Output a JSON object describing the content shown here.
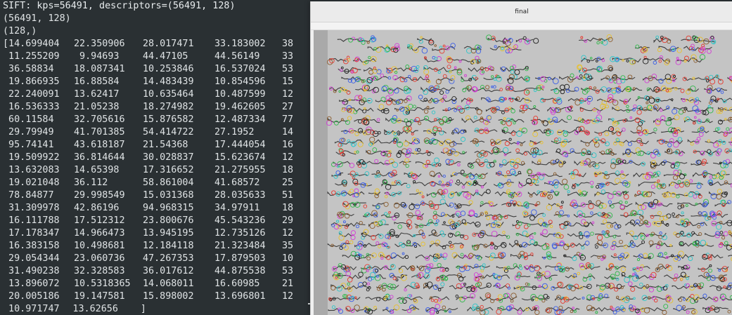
{
  "terminal": {
    "header_lines": [
      "SIFT: kps=56491, descriptors=(56491, 128)",
      "(56491, 128)",
      "(128,)"
    ],
    "vector_rows": [
      [
        "[14.699404",
        "22.350906",
        "28.017471",
        "33.183002",
        "38"
      ],
      [
        " 11.255209",
        " 9.94693",
        "44.47105",
        "44.56149",
        "33"
      ],
      [
        " 36.58834",
        "18.087341",
        "10.253846",
        "16.537024",
        "53"
      ],
      [
        " 19.866935",
        "16.88584",
        "14.483439",
        "10.854596",
        "15"
      ],
      [
        " 22.240091",
        "13.62417",
        "10.635464",
        "10.487599",
        "12"
      ],
      [
        " 16.536333",
        "21.05238",
        "18.274982",
        "19.462605",
        "27"
      ],
      [
        " 60.11584",
        "32.705616",
        "15.876582",
        "12.487334",
        "77"
      ],
      [
        " 29.79949",
        "41.701385",
        "54.414722",
        "27.1952",
        "14"
      ],
      [
        " 95.74141",
        "43.618187",
        "21.54368",
        "17.444054",
        "16"
      ],
      [
        " 19.509922",
        "36.814644",
        "30.028837",
        "15.623674",
        "12"
      ],
      [
        " 13.632083",
        "14.65398",
        "17.316652",
        "21.275955",
        "18"
      ],
      [
        " 19.021048",
        "36.112",
        "58.861004",
        "41.68572",
        "25"
      ],
      [
        " 78.84877",
        "29.998549",
        "15.031368",
        "28.035633",
        "51"
      ],
      [
        " 31.309978",
        "42.86196",
        "94.968315",
        "34.97911",
        "18"
      ],
      [
        " 16.111788",
        "17.512312",
        "23.800676",
        "45.543236",
        "29"
      ],
      [
        " 17.178347",
        "14.966473",
        "13.945195",
        "12.735126",
        "12"
      ],
      [
        " 16.383158",
        "10.498681",
        "12.184118",
        "21.323484",
        "35"
      ],
      [
        " 29.054344",
        "23.060736",
        "47.267353",
        "17.879503",
        "10"
      ],
      [
        " 31.490238",
        "32.328583",
        "36.017612",
        "44.875538",
        "53"
      ],
      [
        " 13.896072",
        "10.5318365",
        "14.068011",
        "16.60985",
        "21"
      ],
      [
        " 20.005186",
        "19.147581",
        "15.898002",
        "13.696801",
        "12"
      ],
      [
        " 10.971747",
        "13.62656",
        "]",
        "",
        ""
      ]
    ]
  },
  "window": {
    "title": "final",
    "image": {
      "description_icon": "keypoint-overlay-image",
      "background_color": "#c4c4c4",
      "marker_colors": [
        "#e6392e",
        "#2fb84a",
        "#3a5ee8",
        "#d43bd6",
        "#e8c02c",
        "#2cc6c9",
        "#8a5a2b",
        "#1f1f1f"
      ]
    }
  }
}
